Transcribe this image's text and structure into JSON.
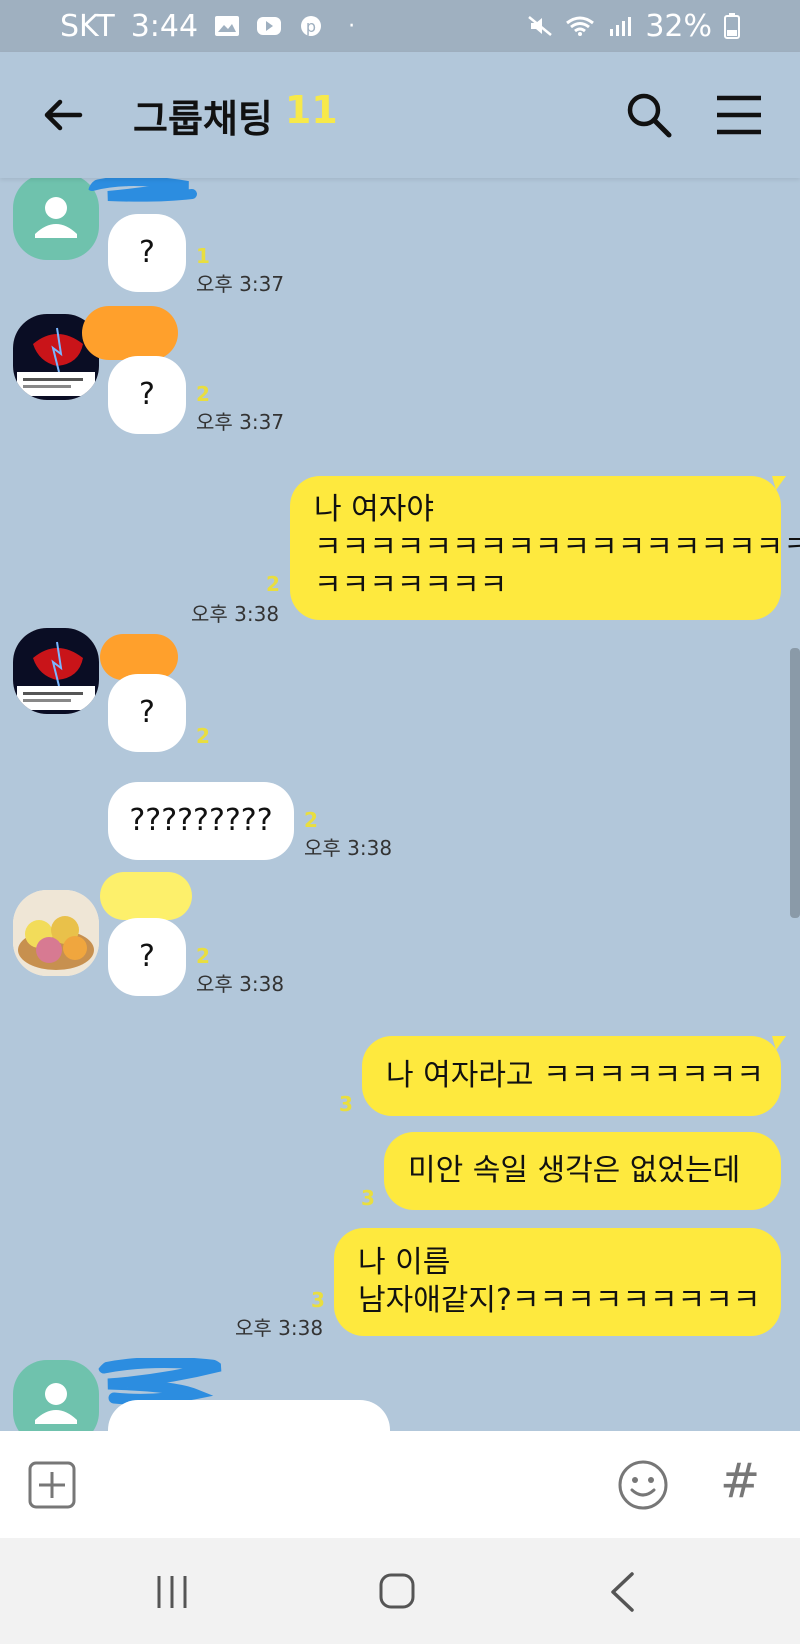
{
  "status_bar": {
    "carrier": "SKT",
    "time": "3:44",
    "battery": "32%",
    "dot": "·"
  },
  "header": {
    "title": "그룹채팅",
    "member_count": "11"
  },
  "messages": [
    {
      "type": "in",
      "text": "?",
      "unread": "1",
      "time": "오후 3:37"
    },
    {
      "type": "in",
      "text": "?",
      "unread": "2",
      "time": "오후 3:37"
    },
    {
      "type": "out",
      "lines": [
        "나 여자야",
        "ㅋㅋㅋㅋㅋㅋㅋㅋㅋㅋㅋㅋㅋㅋㅋㅋㅋㅋㅋ",
        "ㅋㅋㅋㅋㅋㅋㅋ"
      ],
      "unread": "2",
      "time": "오후 3:38"
    },
    {
      "type": "in",
      "text": "?",
      "unread": "2",
      "time": ""
    },
    {
      "type": "in",
      "text": "?????????",
      "unread": "2",
      "time": "오후 3:38"
    },
    {
      "type": "in",
      "text": "?",
      "unread": "2",
      "time": "오후 3:38"
    },
    {
      "type": "out",
      "lines": [
        "나 여자라고 ㅋㅋㅋㅋㅋㅋㅋㅋ"
      ],
      "unread": "3",
      "time": ""
    },
    {
      "type": "out",
      "lines": [
        "미안 속일 생각은 없었는데"
      ],
      "unread": "3",
      "time": ""
    },
    {
      "type": "out",
      "lines": [
        "나 이름",
        "남자애같지?ㅋㅋㅋㅋㅋㅋㅋㅋㅋ"
      ],
      "unread": "3",
      "time": "오후 3:38"
    }
  ],
  "input_bar": {
    "hash_symbol": "#"
  },
  "colors": {
    "chat_bg": "#b2c7da",
    "out_bubble": "#fee93e",
    "in_bubble": "#ffffff",
    "unread": "#e9de3f"
  },
  "icons": [
    "back-arrow-icon",
    "search-icon",
    "menu-icon",
    "plus-icon",
    "emoji-icon",
    "hash-icon",
    "nav-recent-icon",
    "nav-home-icon",
    "nav-back-icon"
  ]
}
